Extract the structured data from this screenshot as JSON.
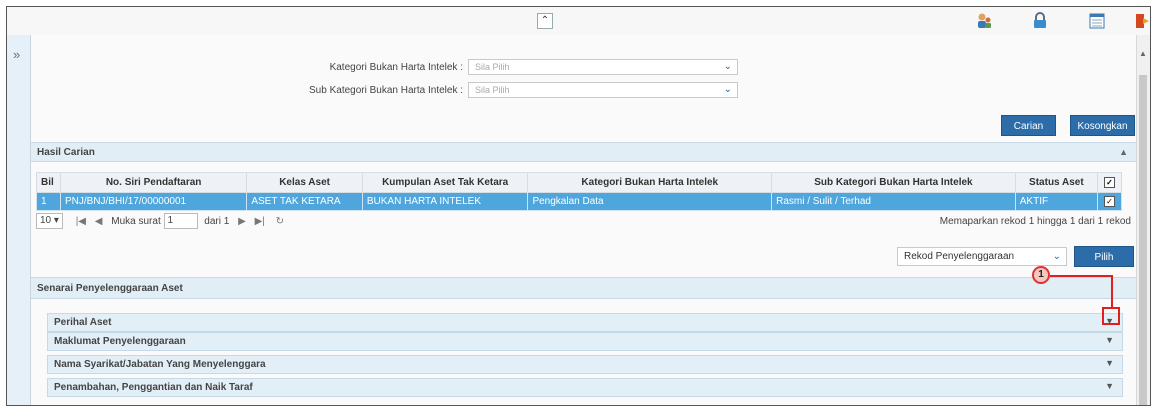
{
  "topbar": {
    "collapse_symbol": "≈",
    "icons": [
      "user-group-icon",
      "lock-icon",
      "calendar-icon",
      "logout-icon"
    ]
  },
  "form": {
    "kategori_label": "Kategori Bukan Harta Intelek :",
    "kategori_placeholder": "Sila Pilih",
    "sub_kategori_label": "Sub Kategori Bukan Harta Intelek :",
    "sub_kategori_placeholder": "Sila Pilih",
    "carian_label": "Carian",
    "kosongkan_label": "Kosongkan"
  },
  "hasil": {
    "title": "Hasil Carian",
    "columns": [
      "Bil",
      "No. Siri Pendaftaran",
      "Kelas Aset",
      "Kumpulan Aset Tak Ketara",
      "Kategori Bukan Harta Intelek",
      "Sub Kategori Bukan Harta Intelek",
      "Status Aset"
    ],
    "rows": [
      {
        "bil": "1",
        "no_siri": "PNJ/BNJ/BHI/17/00000001",
        "kelas": "ASET TAK KETARA",
        "kumpulan": "BUKAN HARTA INTELEK",
        "kategori": "Pengkalan Data",
        "sub_kategori": "Rasmi / Sulit / Terhad",
        "status": "AKTIF"
      }
    ]
  },
  "pager": {
    "page_size": "10 ▾",
    "muka_surat_label": "Muka surat",
    "page_value": "1",
    "dari_label": "dari 1",
    "summary": "Memaparkan rekod 1 hingga 1 dari 1 rekod"
  },
  "rekod": {
    "select_value": "Rekod Penyelenggaraan",
    "pilih_label": "Pilih"
  },
  "senarai": {
    "title": "Senarai Penyelenggaraan Aset",
    "accordion": [
      "Perihal Aset",
      "Maklumat Penyelenggaraan",
      "Nama Syarikat/Jabatan Yang Menyelenggara",
      "Penambahan, Penggantian dan Naik Taraf"
    ]
  },
  "callout": {
    "number": "1"
  },
  "colors": {
    "accent": "#2c6da9",
    "selected_row": "#4fa6dd",
    "callout": "#e02020"
  }
}
